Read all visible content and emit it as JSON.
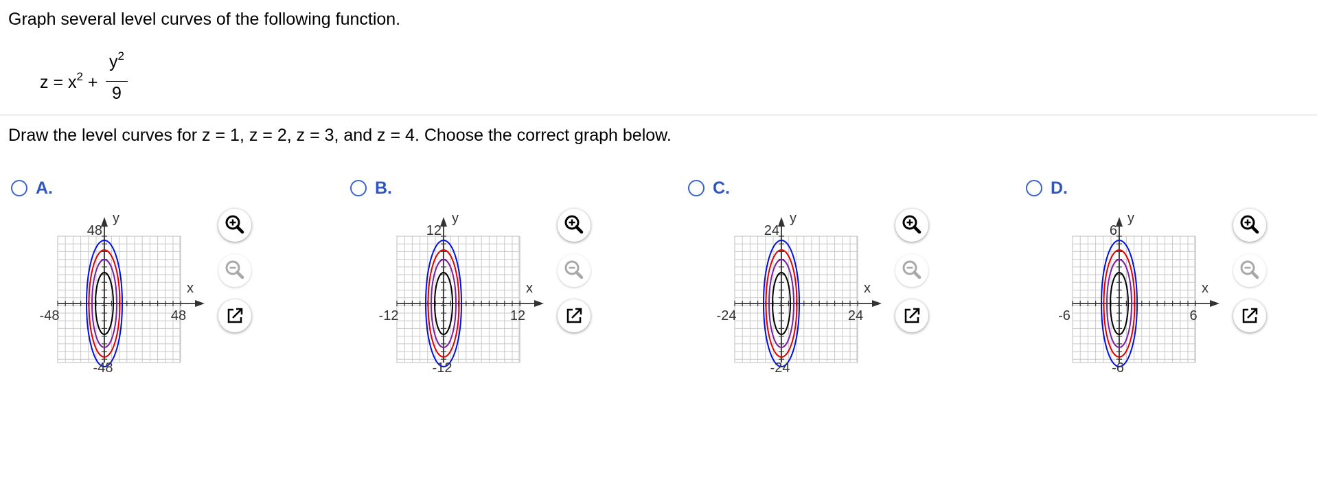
{
  "question": "Graph several level curves of the following function.",
  "formula": {
    "lhs_prefix": "z = x",
    "lhs_exponent": "2",
    "plus": " +",
    "numerator_base": "y",
    "numerator_exponent": "2",
    "denominator": "9"
  },
  "instruction": "Draw the level curves for z = 1, z = 2, z = 3, and z = 4. Choose the correct graph below.",
  "colors": {
    "link_blue": "#2f56c0",
    "radio_border": "#3b64c8",
    "curve_z1": "#000000",
    "curve_z2": "#7a1fa3",
    "curve_z3": "#e00000",
    "curve_z4": "#0010e0",
    "grid": "#c8c8c8"
  },
  "options": [
    {
      "letter": "A.",
      "x_min": "-48",
      "x_max": "48",
      "y_max": "48",
      "y_min": "-48",
      "x_axis": "x",
      "y_axis": "y",
      "tools": [
        "zoom-in-icon",
        "zoom-out-icon",
        "pop-out-icon"
      ]
    },
    {
      "letter": "B.",
      "x_min": "-12",
      "x_max": "12",
      "y_max": "12",
      "y_min": "-12",
      "x_axis": "x",
      "y_axis": "y",
      "tools": [
        "zoom-in-icon",
        "zoom-out-icon",
        "pop-out-icon"
      ]
    },
    {
      "letter": "C.",
      "x_min": "-24",
      "x_max": "24",
      "y_max": "24",
      "y_min": "-24",
      "x_axis": "x",
      "y_axis": "y",
      "tools": [
        "zoom-in-icon",
        "zoom-out-icon",
        "pop-out-icon"
      ]
    },
    {
      "letter": "D.",
      "x_min": "-6",
      "x_max": "6",
      "y_max": "6",
      "y_min": "-6",
      "x_axis": "x",
      "y_axis": "y",
      "tools": [
        "zoom-in-icon",
        "zoom-out-icon",
        "pop-out-icon"
      ]
    }
  ]
}
